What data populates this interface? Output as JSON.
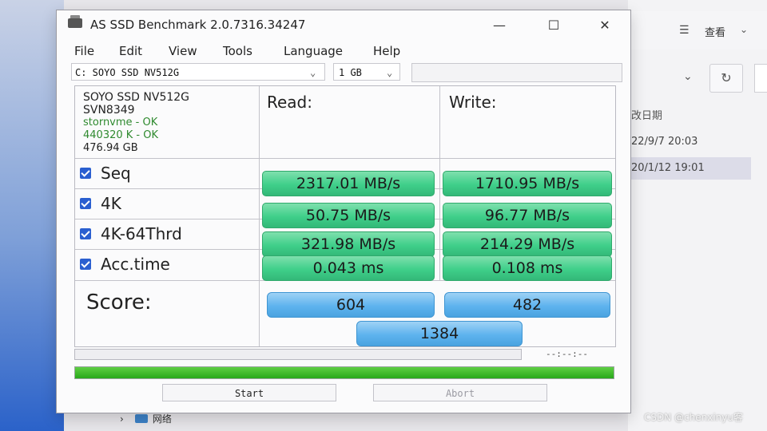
{
  "window": {
    "title": "AS SSD Benchmark 2.0.7316.34247",
    "minimize_glyph": "—",
    "maximize_glyph": "☐",
    "close_glyph": "✕"
  },
  "menu": [
    "File",
    "Edit",
    "View",
    "Tools",
    "Language",
    "Help"
  ],
  "drive_select": {
    "value": "C: SOYO SSD NV512G"
  },
  "size_select": {
    "value": "1 GB"
  },
  "drive_info": {
    "model": "SOYO SSD NV512G",
    "firmware": "SVN8349",
    "driver": "stornvme - OK",
    "alignment": "440320 K - OK",
    "capacity": "476.94 GB"
  },
  "headers": {
    "read": "Read:",
    "write": "Write:"
  },
  "rows": [
    {
      "label": "Seq",
      "read": "2317.01 MB/s",
      "write": "1710.95 MB/s",
      "checked": true
    },
    {
      "label": "4K",
      "read": "50.75 MB/s",
      "write": "96.77 MB/s",
      "checked": true
    },
    {
      "label": "4K-64Thrd",
      "read": "321.98 MB/s",
      "write": "214.29 MB/s",
      "checked": true
    },
    {
      "label": "Acc.time",
      "read": "0.043 ms",
      "write": "0.108 ms",
      "checked": true
    }
  ],
  "score": {
    "label": "Score:",
    "read": "604",
    "write": "482",
    "total": "1384"
  },
  "progress": {
    "time_text": "--:--:--",
    "fraction": 1.0
  },
  "buttons": {
    "start": "Start",
    "abort": "Abort"
  },
  "background": {
    "view_label": "查看",
    "column_header": "改日期",
    "dates": [
      "22/9/7 20:03",
      "20/1/12 19:01"
    ],
    "tree_item": "网络",
    "watermark": "CSDN @chenxinyu客"
  },
  "colors": {
    "result_green": "#3fcf8a",
    "score_blue": "#5eb3ee",
    "progress_green": "#28a81a",
    "checkbox_blue": "#2a5fd0"
  }
}
